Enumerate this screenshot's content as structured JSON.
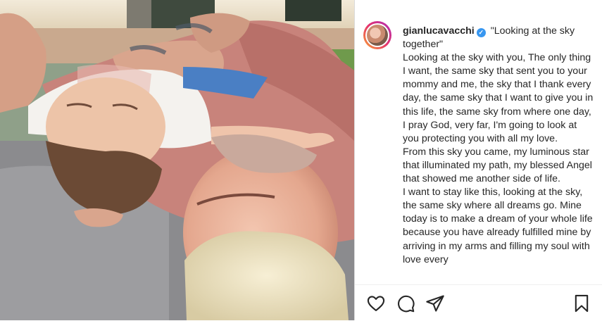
{
  "post": {
    "username": "gianlucavacchi",
    "verified_mark": "✓",
    "title": "\"Looking at the sky together\"",
    "caption_paragraphs": [
      "Looking at the sky with you, The only thing I want, the same sky that sent you to your mommy and me, the sky that I thank every day, the same sky that I want to give you in this life, the same sky from where one day, I pray God, very far, I'm going to look at you protecting you with all my love.",
      "From this sky you came, my luminous star that illuminated my path, my blessed Angel that showed me another side of life.",
      "I want to stay like this, looking at the sky, the same sky where all dreams go. Mine today is to make a dream of your whole life because you have already fulfilled mine by arriving in my arms and filling my soul with love every"
    ]
  },
  "icons": {
    "like": "heart-icon",
    "comment": "comment-icon",
    "share": "share-icon",
    "save": "bookmark-icon",
    "verified": "verified-badge-icon"
  },
  "colors": {
    "verified_blue": "#3897f0",
    "text": "#262626",
    "border": "#dbdbdb"
  }
}
